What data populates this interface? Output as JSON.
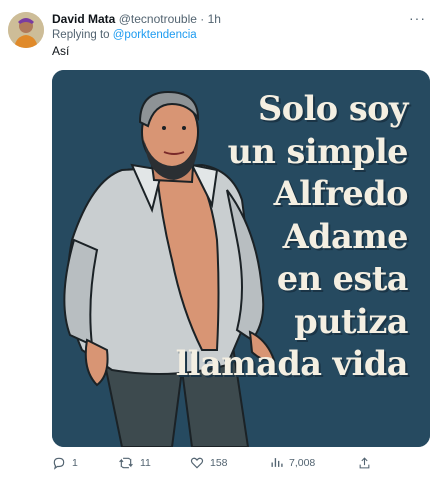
{
  "tweet": {
    "author_name": "David Mata",
    "handle": "@tecnotrouble",
    "separator": "·",
    "time": "1h",
    "more_icon": "more-horizontal-icon",
    "reply_prefix": "Replying to",
    "reply_to": "@porktendencia",
    "text": "Así"
  },
  "media": {
    "caption_lines": [
      "Solo soy",
      "un simple",
      "Alfredo",
      "Adame",
      "en esta",
      "putiza",
      "llamada vida"
    ],
    "background_color": "#264a60",
    "text_color": "#f4efe2"
  },
  "actions": {
    "reply": {
      "icon": "reply-icon",
      "count": "1"
    },
    "retweet": {
      "icon": "retweet-icon",
      "count": "11"
    },
    "like": {
      "icon": "heart-icon",
      "count": "158"
    },
    "views": {
      "icon": "views-icon",
      "count": "7,008"
    },
    "share": {
      "icon": "share-icon"
    }
  },
  "colors": {
    "link": "#1d9bf0",
    "muted": "#536471"
  }
}
